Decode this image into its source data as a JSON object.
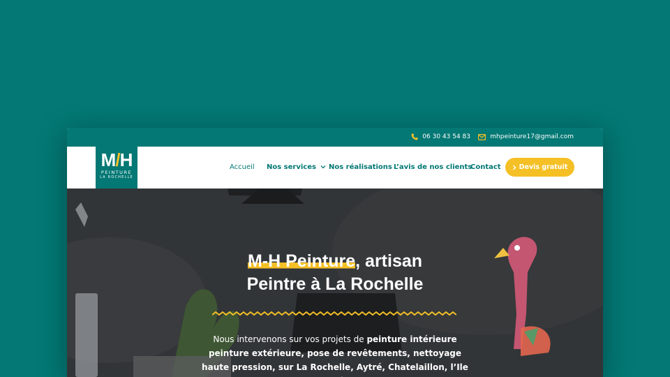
{
  "topbar": {
    "phone": "06 30 43 54 83",
    "email": "mhpeinture17@gmail.com"
  },
  "logo": {
    "letters": "MH",
    "line1": "PEINTURE",
    "line2": "LA ROCHELLE"
  },
  "nav": {
    "items": [
      {
        "label": "Accueil",
        "active": true
      },
      {
        "label": "Nos services",
        "dropdown": true
      },
      {
        "label": "Nos réalisations"
      },
      {
        "label": "L’avis de nos clients"
      },
      {
        "label": "Contact"
      }
    ],
    "cta": "Devis gratuit"
  },
  "hero": {
    "title_line1_highlight": "M-H Peinture",
    "title_line1_rest": ", artisan",
    "title_line2": "Peintre à La Rochelle",
    "text_intro": "Nous intervenons sur vos projets de ",
    "text_b1": "peinture intérieure",
    "text_b2": "peinture extérieure, pose de revêtements, nettoyage haute pression, sur La Rochelle, Aytré, Chatelaillon, l’Ile de Ré...",
    "text_rest": ""
  },
  "colors": {
    "brand": "#037874",
    "accent": "#f4c026"
  }
}
